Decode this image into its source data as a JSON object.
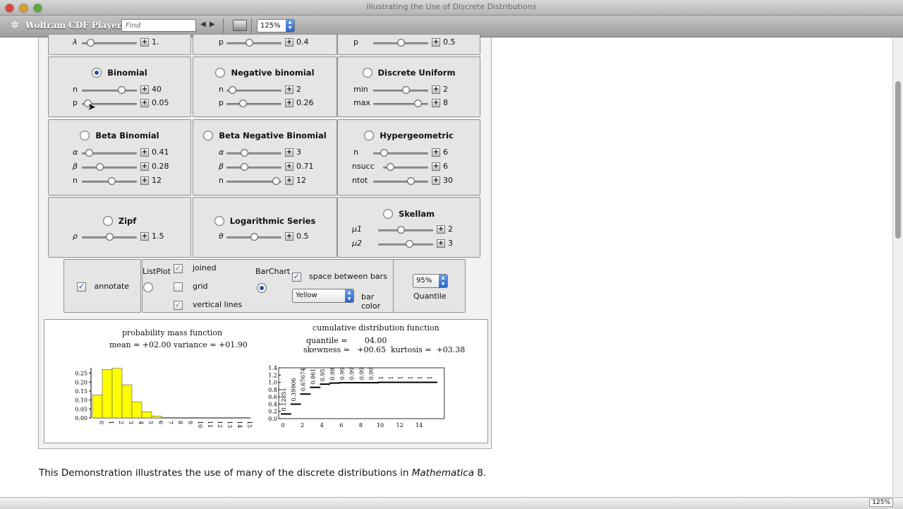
{
  "window": {
    "title": "Illustrating the Use of Discrete Distributions"
  },
  "toolbar": {
    "app_name": "Wolfram CDF Player",
    "find_placeholder": "Find",
    "zoom": "125%"
  },
  "distributions": [
    {
      "id": "top1",
      "name": "",
      "selected": false,
      "params": [
        {
          "label": "λ",
          "value": "1.",
          "pos": 0.1
        }
      ]
    },
    {
      "id": "top2",
      "name": "",
      "selected": false,
      "params": [
        {
          "label": "p",
          "value": "0.4",
          "pos": 0.4
        }
      ]
    },
    {
      "id": "top3",
      "name": "",
      "selected": false,
      "params": [
        {
          "label": "p",
          "value": "0.5",
          "pos": 0.5
        }
      ]
    },
    {
      "id": "binomial",
      "name": "Binomial",
      "selected": true,
      "params": [
        {
          "label": "n",
          "value": "40",
          "pos": 0.75
        },
        {
          "label": "p",
          "value": "0.05",
          "pos": 0.05
        }
      ]
    },
    {
      "id": "negbinomial",
      "name": "Negative binomial",
      "selected": false,
      "params": [
        {
          "label": "n",
          "value": "2",
          "pos": 0.05
        },
        {
          "label": "p",
          "value": "0.26",
          "pos": 0.26
        }
      ]
    },
    {
      "id": "discreteuniform",
      "name": "Discrete Uniform",
      "selected": false,
      "params": [
        {
          "label": "min",
          "value": "2",
          "pos": 0.6
        },
        {
          "label": "max",
          "value": "8",
          "pos": 0.85
        }
      ]
    },
    {
      "id": "betabinomial",
      "name": "Beta Binomial",
      "selected": false,
      "params": [
        {
          "label": "α",
          "value": "0.41",
          "pos": 0.08
        },
        {
          "label": "β",
          "value": "0.28",
          "pos": 0.3
        },
        {
          "label": "n",
          "value": "12",
          "pos": 0.55
        }
      ]
    },
    {
      "id": "betanegbinomial",
      "name": "Beta Negative Binomial",
      "selected": false,
      "params": [
        {
          "label": "α",
          "value": "3",
          "pos": 0.3
        },
        {
          "label": "β",
          "value": "0.71",
          "pos": 0.3
        },
        {
          "label": "n",
          "value": "12",
          "pos": 0.95
        }
      ]
    },
    {
      "id": "hypergeometric",
      "name": "Hypergeometric",
      "selected": false,
      "params": [
        {
          "label": "n",
          "value": "6",
          "pos": 0.15
        },
        {
          "label": "nsucc",
          "value": "6",
          "pos": 0.1
        },
        {
          "label": "ntot",
          "value": "30",
          "pos": 0.7
        }
      ]
    },
    {
      "id": "zipf",
      "name": "Zipf",
      "selected": false,
      "params": [
        {
          "label": "ρ",
          "value": "1.5",
          "pos": 0.5
        }
      ]
    },
    {
      "id": "logseries",
      "name": "Logarithmic Series",
      "selected": false,
      "params": [
        {
          "label": "θ",
          "value": "0.5",
          "pos": 0.5
        }
      ]
    },
    {
      "id": "skellam",
      "name": "Skellam",
      "selected": false,
      "params": [
        {
          "label": "μ1",
          "value": "2",
          "pos": 0.4
        },
        {
          "label": "μ2",
          "value": "3",
          "pos": 0.58
        }
      ]
    }
  ],
  "options": {
    "annotate": "annotate",
    "listplot": "ListPlot",
    "joined": "joined",
    "grid": "grid",
    "vertical_lines": "vertical lines",
    "barchart": "BarChart",
    "space_between_bars": "space between bars",
    "bar_color_value": "Yellow",
    "bar_color_label": "bar color",
    "quantile_value": "95%",
    "quantile_label": "Quantile"
  },
  "pmf": {
    "title": "probability mass function",
    "stats": "mean = +02.00  variance = +01.90",
    "ytick_labels": [
      "0.00",
      "0.05",
      "0.10",
      "0.15",
      "0.20",
      "0.25"
    ],
    "xtick_labels": [
      "0",
      "1",
      "2",
      "3",
      "4",
      "5",
      "6",
      "7",
      "8",
      "9",
      "10",
      "11",
      "12",
      "13",
      "14",
      "15"
    ],
    "values": [
      0.129,
      0.271,
      0.277,
      0.185,
      0.09,
      0.034,
      0.01,
      0.003,
      0.001,
      0.0,
      0.0,
      0.0,
      0.0,
      0.0,
      0.0,
      0.0
    ],
    "bar_color": "#ffff00"
  },
  "cdf": {
    "title": "cumulative distribution function",
    "quantile_line": "quantile =       04.00",
    "moments_line": "skewness =   +00.65  kurtosis =  +03.38",
    "ytick_labels": [
      "0.0",
      "0.2",
      "0.4",
      "0.6",
      "0.8",
      "1.0",
      "1.2",
      "1.4"
    ],
    "xtick_labels": [
      "0",
      "2",
      "4",
      "6",
      "8",
      "10",
      "12",
      "14"
    ],
    "values": [
      0.12851,
      0.39906,
      0.67674,
      0.8619,
      0.95,
      0.98,
      0.99,
      0.99,
      0.99,
      0.99,
      1,
      1,
      1,
      1,
      1,
      1
    ],
    "labels": [
      "0.12851",
      "0.39906",
      "0.67674",
      "0.861",
      "0.95",
      "0.98",
      "0.99",
      "0.99",
      "0.99",
      "0.99",
      "1",
      "1",
      "1",
      "1",
      "1",
      "1"
    ]
  },
  "description": {
    "pre": "This Demonstration illustrates the use of many of the discrete distributions in ",
    "em": "Mathematica",
    "post": " 8."
  },
  "footer": {
    "zoom": "125%"
  }
}
